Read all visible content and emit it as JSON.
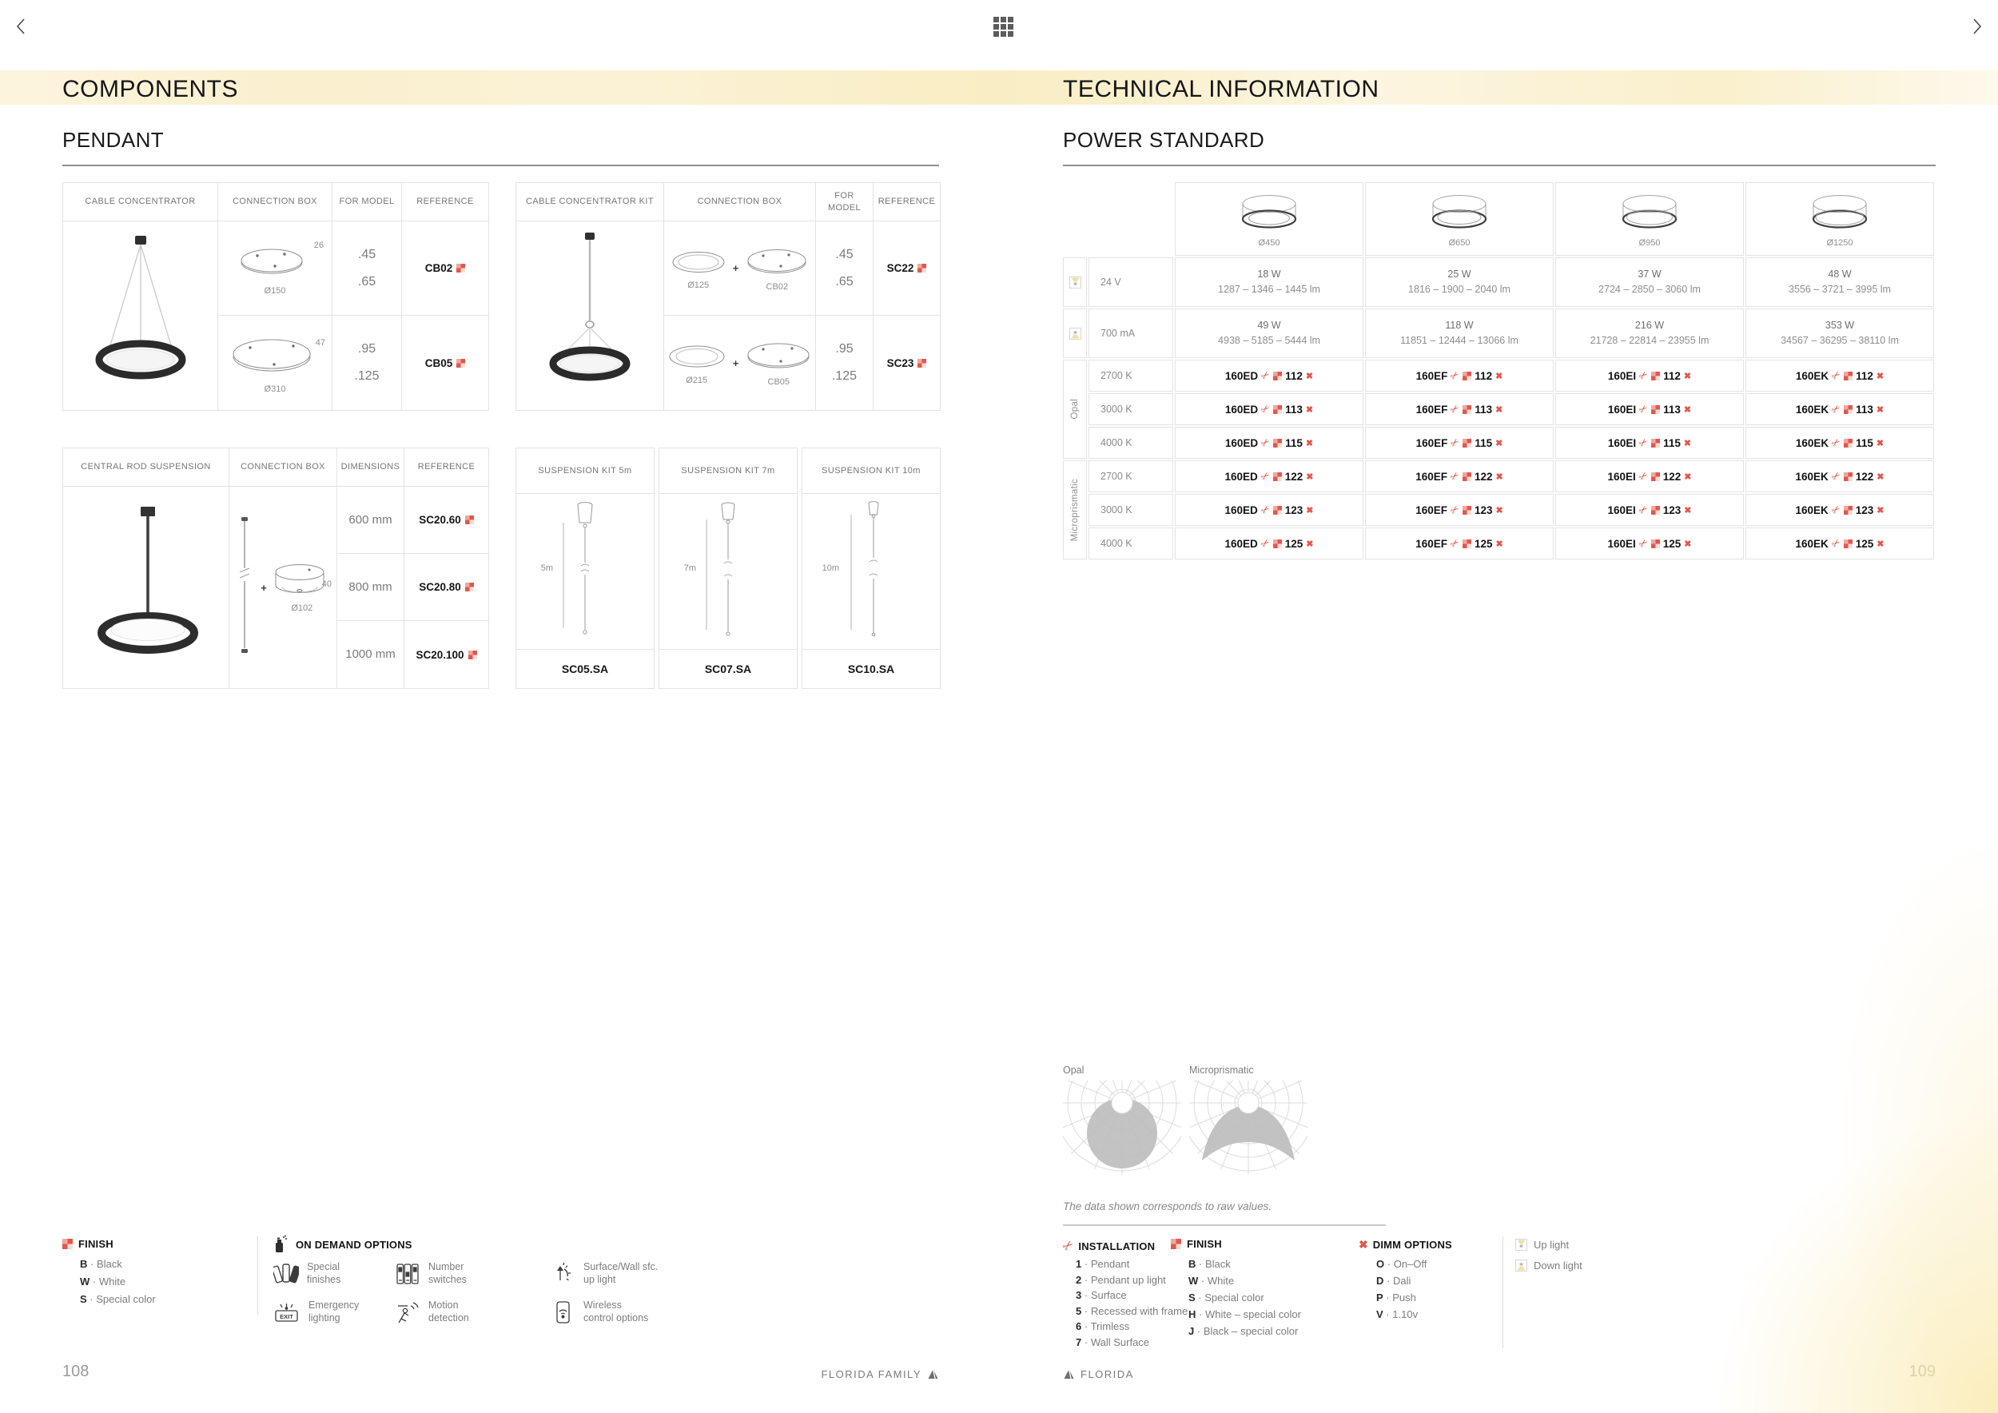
{
  "shared": {
    "dot": "·",
    "plus": "+"
  },
  "icons": {
    "scissors": "✂",
    "dimm": "✖"
  },
  "left": {
    "title": "COMPONENTS",
    "section": "PENDANT",
    "t1": {
      "h": [
        "CABLE CONCENTRATOR",
        "CONNECTION BOX",
        "FOR MODEL",
        "REFERENCE"
      ],
      "r1": {
        "dia": "Ø150",
        "side": "26",
        "m1": ".45",
        "m2": ".65",
        "ref": "CB02"
      },
      "r2": {
        "dia": "Ø310",
        "side": "47",
        "m1": ".95",
        "m2": ".125",
        "ref": "CB05"
      }
    },
    "t2": {
      "h": [
        "CABLE CONCENTRATOR KIT",
        "CONNECTION BOX",
        "FOR MODEL",
        "REFERENCE"
      ],
      "r1": {
        "ring": "Ø125",
        "box": "CB02",
        "m1": ".45",
        "m2": ".65",
        "ref": "SC22"
      },
      "r2": {
        "ring": "Ø215",
        "box": "CB05",
        "m1": ".95",
        "m2": ".125",
        "ref": "SC23"
      }
    },
    "t3": {
      "h": [
        "CENTRAL ROD SUSPENSION",
        "CONNECTION BOX",
        "DIMENSIONS",
        "REFERENCE"
      ],
      "box": {
        "dia": "Ø102",
        "side": "40"
      },
      "rows": [
        {
          "dim": "600 mm",
          "ref": "SC20.60"
        },
        {
          "dim": "800 mm",
          "ref": "SC20.80"
        },
        {
          "dim": "1000 mm",
          "ref": "SC20.100"
        }
      ]
    },
    "kits": [
      {
        "title": "SUSPENSION KIT 5m",
        "len": "5m",
        "code": "SC05.SA"
      },
      {
        "title": "SUSPENSION KIT 7m",
        "len": "7m",
        "code": "SC07.SA"
      },
      {
        "title": "SUSPENSION KIT 10m",
        "len": "10m",
        "code": "SC10.SA"
      }
    ],
    "finish": {
      "title": "FINISH",
      "items": [
        {
          "k": "B",
          "v": "Black"
        },
        {
          "k": "W",
          "v": "White"
        },
        {
          "k": "S",
          "v": "Special color"
        }
      ]
    },
    "ondemand": {
      "title": "ON DEMAND OPTIONS",
      "exit": "EXIT",
      "items": [
        {
          "l1": "Special",
          "l2": "finishes"
        },
        {
          "l1": "Number",
          "l2": "switches"
        },
        {
          "l1": "Surface/Wall sfc.",
          "l2": "up light"
        },
        {
          "l1": "Emergency",
          "l2": "lighting"
        },
        {
          "l1": "Motion",
          "l2": "detection"
        },
        {
          "l1": "Wireless",
          "l2": "control options"
        }
      ]
    },
    "footer": {
      "page": "108",
      "brand": "FLORIDA FAMILY"
    }
  },
  "right": {
    "title": "TECHNICAL INFORMATION",
    "section": "POWER STANDARD",
    "power": {
      "cols": [
        "Ø450",
        "Ø650",
        "Ø950",
        "Ø1250"
      ],
      "codes": [
        "160ED",
        "160EF",
        "160EI",
        "160EK"
      ],
      "rows": [
        {
          "label": "24 V",
          "cells": [
            {
              "w": "18 W",
              "lm": "1287 – 1346 – 1445 lm"
            },
            {
              "w": "25 W",
              "lm": "1816 – 1900 – 2040 lm"
            },
            {
              "w": "37 W",
              "lm": "2724 – 2850 – 3060 lm"
            },
            {
              "w": "48 W",
              "lm": "3556 – 3721 – 3995 lm"
            }
          ]
        },
        {
          "label": "700 mA",
          "cells": [
            {
              "w": "49 W",
              "lm": "4938 – 5185 – 5444 lm"
            },
            {
              "w": "118 W",
              "lm": "11851 – 12444 – 13066 lm"
            },
            {
              "w": "216 W",
              "lm": "21728 – 22814 – 23955 lm"
            },
            {
              "w": "353 W",
              "lm": "34567 – 36295 – 38110 lm"
            }
          ]
        }
      ],
      "groups": [
        {
          "name": "Opal",
          "rows": [
            {
              "k": "2700 K",
              "sfx": "112"
            },
            {
              "k": "3000 K",
              "sfx": "113"
            },
            {
              "k": "4000 K",
              "sfx": "115"
            }
          ]
        },
        {
          "name": "Microprismatic",
          "rows": [
            {
              "k": "2700 K",
              "sfx": "122"
            },
            {
              "k": "3000 K",
              "sfx": "123"
            },
            {
              "k": "4000 K",
              "sfx": "125"
            }
          ]
        }
      ]
    },
    "diagrams": {
      "opal": "Opal",
      "micro": "Microprismatic",
      "note": "The data shown corresponds to raw values."
    },
    "installation": {
      "title": "INSTALLATION",
      "items": [
        {
          "k": "1",
          "v": "Pendant"
        },
        {
          "k": "2",
          "v": "Pendant up light"
        },
        {
          "k": "3",
          "v": "Surface"
        },
        {
          "k": "5",
          "v": "Recessed with frame"
        },
        {
          "k": "6",
          "v": "Trimless"
        },
        {
          "k": "7",
          "v": "Wall Surface"
        }
      ]
    },
    "finish": {
      "title": "FINISH",
      "items": [
        {
          "k": "B",
          "v": "Black"
        },
        {
          "k": "W",
          "v": "White"
        },
        {
          "k": "S",
          "v": "Special color"
        },
        {
          "k": "H",
          "v": "White – special color"
        },
        {
          "k": "J",
          "v": "Black – special color"
        }
      ]
    },
    "dimm": {
      "title": "DIMM OPTIONS",
      "items": [
        {
          "k": "O",
          "v": "On–Off"
        },
        {
          "k": "D",
          "v": "Dali"
        },
        {
          "k": "P",
          "v": "Push"
        },
        {
          "k": "V",
          "v": "1.10v"
        }
      ]
    },
    "lights": [
      {
        "label": "Up light"
      },
      {
        "label": "Down light"
      }
    ],
    "footer": {
      "brand": "FLORIDA",
      "page": "109"
    }
  },
  "colors": {
    "accent": "#e2574c",
    "band": "#f9edc3"
  }
}
